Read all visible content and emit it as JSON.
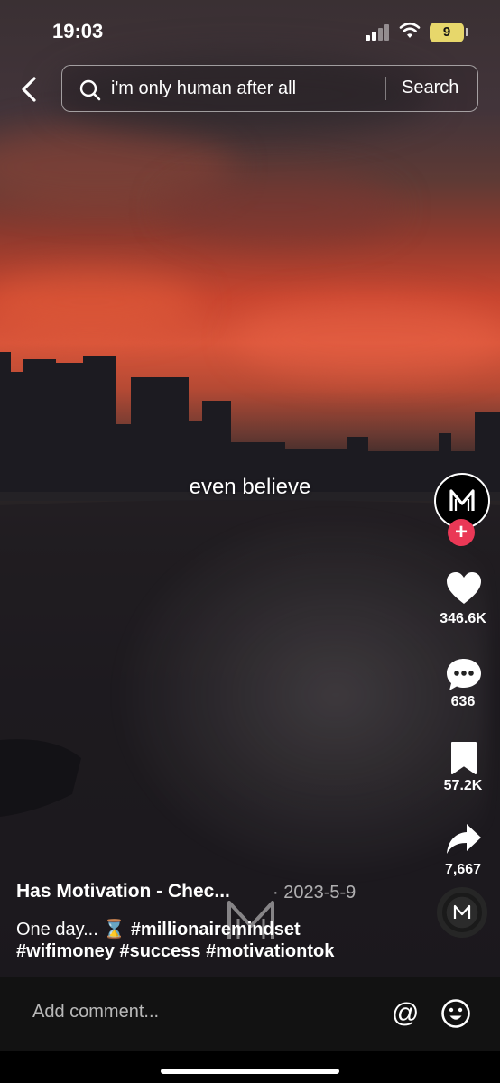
{
  "status_bar": {
    "time": "19:03",
    "battery_level": "9",
    "battery_color": "#e7d76b"
  },
  "search": {
    "query": "i'm only human after all",
    "button_label": "Search"
  },
  "video": {
    "caption": "even believe"
  },
  "side_actions": {
    "likes": "346.6K",
    "comments": "636",
    "saves": "57.2K",
    "shares": "7,667"
  },
  "post": {
    "author": "Has Motivation - Chec...",
    "date": "· 2023-5-9",
    "description_prefix": "One day... ⌛",
    "description_tag1": "#millionairemindset",
    "description_line2": "#wifimoney #success #motivationtok"
  },
  "comment_bar": {
    "placeholder": "Add comment..."
  },
  "colors": {
    "follow_accent": "#ea3856",
    "sky_red": "#d9553a"
  },
  "icons": [
    "back-chevron-icon",
    "search-icon",
    "heart-icon",
    "comment-icon",
    "bookmark-icon",
    "share-icon",
    "at-icon",
    "emoji-icon"
  ]
}
